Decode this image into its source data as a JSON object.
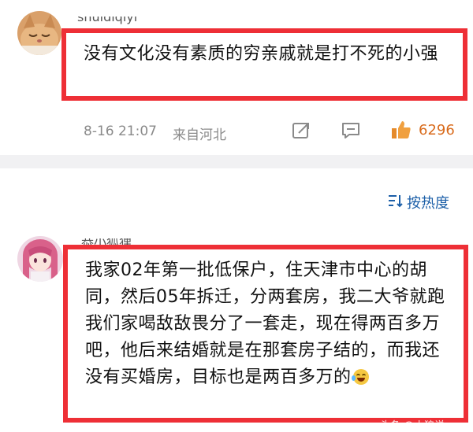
{
  "comments": [
    {
      "username": "shuidiqiyi",
      "avatar_icon": "cat-avatar-icon",
      "text": "没有文化没有素质的穷亲戚就是打不死的小强",
      "time": "8-16 21:07",
      "location": "来自河北",
      "like_count": "6296"
    },
    {
      "username": "恭小狐狸_",
      "avatar_icon": "anime-girl-avatar-icon",
      "text": "我家02年第一批低保户，住天津市中心的胡同，然后05年拆迁，分两套房，我二大爷就跑我们家喝敌敌畏分了一套走，现在得两百多万吧，他后来结婚就是在那套房子结的，而我还没有买婚房，目标也是两百多万的",
      "emoji": "laughing-crying-emoji"
    }
  ],
  "sort": {
    "label": "按热度",
    "icon": "sort-icon"
  },
  "watermark": "头条 @小狼说",
  "colors": {
    "highlight": "#ee2f36",
    "link": "#1c5fa8",
    "like": "#d96b1c"
  }
}
